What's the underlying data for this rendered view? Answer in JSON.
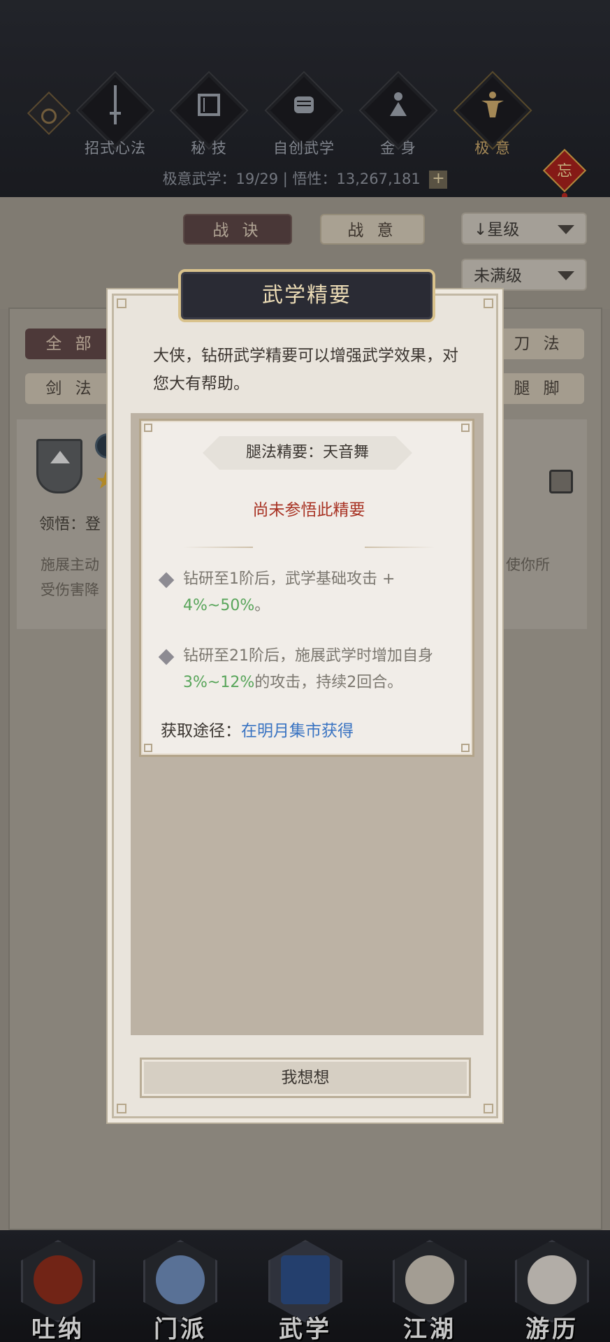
{
  "header": {
    "categories": [
      {
        "label": "招式心法",
        "icon": "sword-icon",
        "active": false
      },
      {
        "label": "秘 技",
        "icon": "book-icon",
        "active": false
      },
      {
        "label": "自创武学",
        "icon": "scroll-icon",
        "active": false
      },
      {
        "label": "金 身",
        "icon": "meditation-icon",
        "active": false
      },
      {
        "label": "极 意",
        "icon": "martial-pose-icon",
        "active": true
      }
    ],
    "knot_char": "忘",
    "stats_text": "极意武学：19/29 | 悟性：13,267,181",
    "plus_label": "+"
  },
  "filters": {
    "tab_zhanjue": "战 诀",
    "tab_zhanyi": "战 意",
    "sort_label": "↓星级",
    "level_label": "未满级"
  },
  "list": {
    "tags": [
      "全 部",
      "刀 法",
      "剑 法",
      "腿 脚"
    ],
    "item_comprehend": "领悟：登",
    "item_desc_left_1": "施展主动",
    "item_desc_left_2": "受伤害降",
    "item_desc_right": "使你所"
  },
  "modal": {
    "title": "武学精要",
    "intro": "大侠，钻研武学精要可以增强武学效果，对您大有帮助。",
    "essence_name": "腿法精要：天音舞",
    "status": "尚未参悟此精要",
    "effects": [
      {
        "pre": "钻研至1阶后，武学基础攻击 + ",
        "hl": "4%~50%",
        "post": "。"
      },
      {
        "pre": "钻研至21阶后，施展武学时增加自身",
        "hl": "3%~12%",
        "post": "的攻击，持续2回合。"
      }
    ],
    "acquire_label": "获取途径：",
    "acquire_link": "在明月集市获得",
    "confirm_button": "我想想"
  },
  "bottom_nav": [
    {
      "label": "吐纳",
      "active": false
    },
    {
      "label": "门派",
      "active": false
    },
    {
      "label": "武学",
      "active": true
    },
    {
      "label": "江湖",
      "active": false
    },
    {
      "label": "游历",
      "active": false
    }
  ],
  "colors": {
    "accent_gold": "#d9c28c",
    "status_red": "#a83324",
    "value_green": "#58a55a",
    "link_blue": "#3a74c2"
  }
}
